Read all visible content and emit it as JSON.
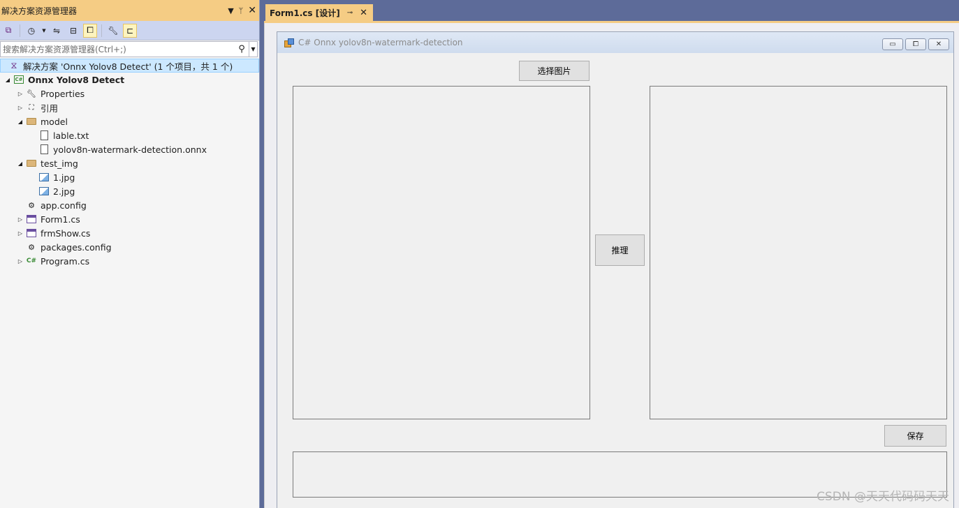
{
  "solution_explorer": {
    "title": "解决方案资源管理器",
    "search_placeholder": "搜索解决方案资源管理器(Ctrl+;)",
    "solution_label": "解决方案 'Onnx Yolov8 Detect' (1 个项目，共 1 个)",
    "project_label": "Onnx Yolov8 Detect",
    "items": [
      {
        "label": "Properties"
      },
      {
        "label": "引用"
      },
      {
        "label": "model"
      },
      {
        "label": "lable.txt"
      },
      {
        "label": "yolov8n-watermark-detection.onnx"
      },
      {
        "label": "test_img"
      },
      {
        "label": "1.jpg"
      },
      {
        "label": "2.jpg"
      },
      {
        "label": "app.config"
      },
      {
        "label": "Form1.cs"
      },
      {
        "label": "frmShow.cs"
      },
      {
        "label": "packages.config"
      },
      {
        "label": "Program.cs"
      }
    ]
  },
  "doc_tab": {
    "label": "Form1.cs [设计]"
  },
  "form": {
    "title": "C# Onnx yolov8n-watermark-detection",
    "select_button": "选择图片",
    "infer_button": "推理",
    "save_button": "保存"
  },
  "watermark": "CSDN @天天代码码天天",
  "colors": {
    "title_accent": "#f5cc84",
    "toolbar_bg": "#ccd5f0",
    "chrome_bg": "#5d6b99",
    "selection": "#cce8ff"
  }
}
